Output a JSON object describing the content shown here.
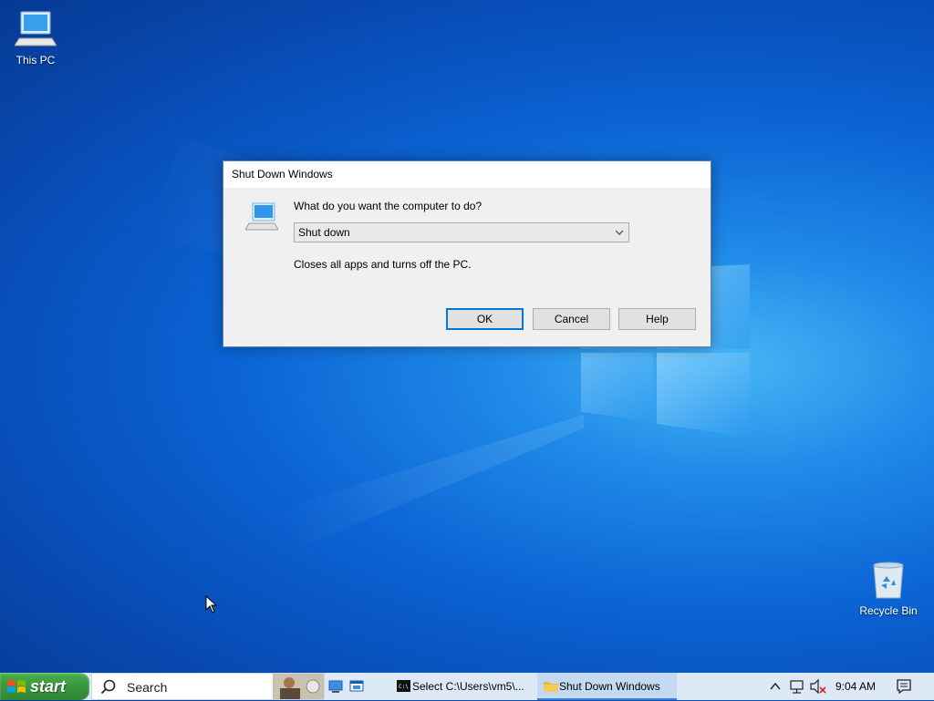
{
  "desktop": {
    "icons": [
      {
        "label": "This PC"
      },
      {
        "label": "Recycle Bin"
      }
    ]
  },
  "dialog": {
    "title": "Shut Down Windows",
    "prompt": "What do you want the computer to do?",
    "selected_option": "Shut down",
    "description": "Closes all apps and turns off the PC.",
    "buttons": {
      "ok": "OK",
      "cancel": "Cancel",
      "help": "Help"
    }
  },
  "taskbar": {
    "start_label": "start",
    "search_placeholder": "Search",
    "tasks": [
      {
        "label": "Select C:\\Users\\vm5\\...",
        "icon": "cmd-icon"
      },
      {
        "label": "Shut Down Windows",
        "icon": "folder-icon",
        "active": true
      }
    ],
    "clock": "9:04 AM"
  }
}
